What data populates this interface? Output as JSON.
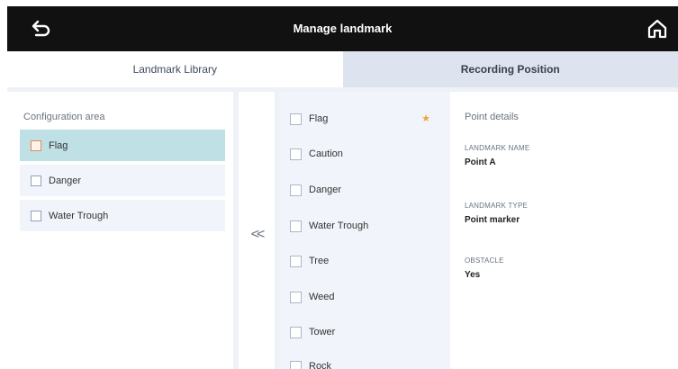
{
  "header": {
    "title": "Manage landmark",
    "back_icon": "back-arrow-icon",
    "home_icon": "home-icon"
  },
  "tabs": [
    {
      "label": "Landmark Library",
      "active": true
    },
    {
      "label": "Recording Position",
      "active": false
    }
  ],
  "config_area": {
    "heading": "Configuration area",
    "items": [
      {
        "label": "Flag",
        "selected": true
      },
      {
        "label": "Danger",
        "selected": false
      },
      {
        "label": "Water Trough",
        "selected": false
      }
    ]
  },
  "collapse_label": "<<",
  "library": {
    "items": [
      {
        "label": "Flag",
        "starred": true
      },
      {
        "label": "Caution",
        "starred": false
      },
      {
        "label": "Danger",
        "starred": false
      },
      {
        "label": "Water Trough",
        "starred": false
      },
      {
        "label": "Tree",
        "starred": false
      },
      {
        "label": "Weed",
        "starred": false
      },
      {
        "label": "Tower",
        "starred": false
      },
      {
        "label": "Rock",
        "starred": false
      }
    ],
    "star_glyph": "★"
  },
  "details": {
    "heading": "Point details",
    "fields": [
      {
        "label": "LANDMARK NAME",
        "value": "Point A"
      },
      {
        "label": "LANDMARK TYPE",
        "value": "Point marker"
      },
      {
        "label": "OBSTACLE",
        "value": "Yes"
      }
    ]
  },
  "colors": {
    "topbar": "#111111",
    "selected_item": "#bfe1e6",
    "star": "#f0a43c",
    "accent_checkbox": "#e08a55"
  }
}
